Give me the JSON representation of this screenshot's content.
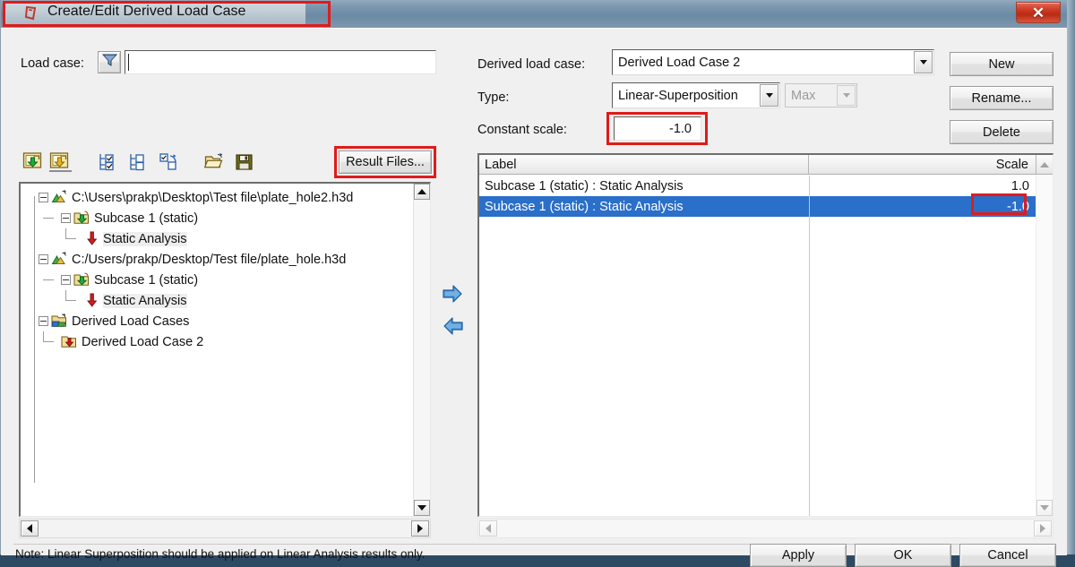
{
  "window": {
    "title": "Create/Edit Derived Load Case",
    "close_label": "✕",
    "title_icon": "altair-logo-icon"
  },
  "left_panel": {
    "load_case_label": "Load case:",
    "load_case_filter_icon": "filter-funnel-icon",
    "load_case_value": "",
    "toolbar": [
      {
        "name": "import-load-case-green-icon",
        "title": ""
      },
      {
        "name": "import-load-case-yellow-icon",
        "title": ""
      },
      {
        "name": "check-all-icon",
        "title": ""
      },
      {
        "name": "uncheck-all-icon",
        "title": ""
      },
      {
        "name": "invert-selection-icon",
        "title": ""
      },
      {
        "name": "open-folder-icon",
        "title": ""
      },
      {
        "name": "save-disk-icon",
        "title": ""
      }
    ],
    "result_files_button": "Result Files...",
    "tree": [
      {
        "indent": 0,
        "label": "C:\\Users\\prakp\\Desktop\\Test file\\plate_hole2.h3d",
        "icon": "h3d-file-icon",
        "expander": "minus",
        "highlight": false
      },
      {
        "indent": 1,
        "label": "Subcase 1 (static)",
        "icon": "subcase-folder-icon",
        "expander": "minus",
        "highlight": false
      },
      {
        "indent": 2,
        "label": "Static Analysis",
        "icon": "red-arrow-down-icon",
        "expander": "none",
        "highlight": false
      },
      {
        "indent": 0,
        "label": "C:/Users/prakp/Desktop/Test file/plate_hole.h3d",
        "icon": "h3d-file-icon",
        "expander": "minus",
        "highlight": false
      },
      {
        "indent": 1,
        "label": "Subcase 1 (static)",
        "icon": "subcase-folder-icon",
        "expander": "minus",
        "highlight": false
      },
      {
        "indent": 2,
        "label": "Static Analysis",
        "icon": "red-arrow-down-icon",
        "expander": "none",
        "highlight": true
      },
      {
        "indent": 0,
        "label": "Derived Load Cases",
        "icon": "derived-load-cases-icon",
        "expander": "minus",
        "highlight": false
      },
      {
        "indent": 1,
        "label": "Derived Load Case 2",
        "icon": "derived-load-case-icon",
        "expander": "none",
        "highlight": false
      }
    ]
  },
  "transfer": {
    "add_icon": "arrow-right-blue-icon",
    "remove_icon": "arrow-left-blue-icon"
  },
  "right_panel": {
    "derived_load_case_label": "Derived load case:",
    "derived_load_case_value": "Derived Load Case 2",
    "type_label": "Type:",
    "type_value": "Linear-Superposition",
    "envelope_value": "Max",
    "envelope_disabled": true,
    "constant_scale_label": "Constant scale:",
    "constant_scale_value": "-1.0",
    "buttons": {
      "new": "New",
      "rename": "Rename...",
      "delete": "Delete"
    },
    "table": {
      "columns": [
        "Label",
        "Scale"
      ],
      "rows": [
        {
          "label": "Subcase 1 (static) : Static Analysis",
          "scale": "1.0",
          "selected": false
        },
        {
          "label": "Subcase 1 (static) : Static Analysis",
          "scale": "-1.0",
          "selected": true
        }
      ]
    }
  },
  "footer": {
    "note": "Note: Linear Superposition should be applied on Linear Analysis results only.",
    "apply": "Apply",
    "ok": "OK",
    "cancel": "Cancel"
  },
  "annotations": {
    "accent_color": "#e01b1b",
    "selection_color": "#2a6fc9",
    "highlight_boxes": [
      "title-bar",
      "result-files-button",
      "constant-scale-field",
      "selected-row-scale-cell"
    ]
  }
}
